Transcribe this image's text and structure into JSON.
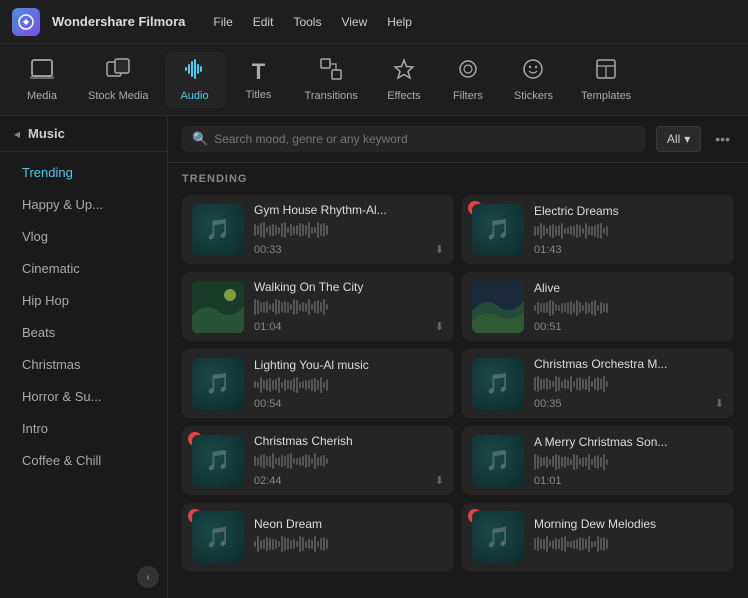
{
  "app": {
    "logo": "W",
    "name": "Wondershare Filmora"
  },
  "titlebar": {
    "menus": [
      "File",
      "Edit",
      "Tools",
      "View",
      "Help"
    ]
  },
  "toolbar": {
    "items": [
      {
        "id": "media",
        "label": "Media",
        "icon": "⬛",
        "active": false
      },
      {
        "id": "stock",
        "label": "Stock Media",
        "icon": "🎞",
        "active": false
      },
      {
        "id": "audio",
        "label": "Audio",
        "icon": "🎵",
        "active": true
      },
      {
        "id": "titles",
        "label": "Titles",
        "icon": "T",
        "active": false
      },
      {
        "id": "transitions",
        "label": "Transitions",
        "icon": "⧉",
        "active": false
      },
      {
        "id": "effects",
        "label": "Effects",
        "icon": "✦",
        "active": false
      },
      {
        "id": "filters",
        "label": "Filters",
        "icon": "◎",
        "active": false
      },
      {
        "id": "stickers",
        "label": "Stickers",
        "icon": "🎭",
        "active": false
      },
      {
        "id": "templates",
        "label": "Templates",
        "icon": "⬜",
        "active": false
      }
    ]
  },
  "sidebar": {
    "header": "Music",
    "items": [
      {
        "id": "trending",
        "label": "Trending",
        "active": true
      },
      {
        "id": "happy",
        "label": "Happy & Up...",
        "active": false
      },
      {
        "id": "vlog",
        "label": "Vlog",
        "active": false
      },
      {
        "id": "cinematic",
        "label": "Cinematic",
        "active": false
      },
      {
        "id": "hiphop",
        "label": "Hip Hop",
        "active": false
      },
      {
        "id": "beats",
        "label": "Beats",
        "active": false
      },
      {
        "id": "christmas",
        "label": "Christmas",
        "active": false
      },
      {
        "id": "horror",
        "label": "Horror & Su...",
        "active": false
      },
      {
        "id": "intro",
        "label": "Intro",
        "active": false
      },
      {
        "id": "coffee",
        "label": "Coffee & Chill",
        "active": false
      }
    ]
  },
  "search": {
    "placeholder": "Search mood, genre or any keyword"
  },
  "filter": {
    "label": "All"
  },
  "section": {
    "title": "TRENDING"
  },
  "music": {
    "items": [
      {
        "id": "gym",
        "title": "Gym House Rhythm-Al...",
        "duration": "00:33",
        "premium": false,
        "thumb": "teal",
        "dl": true
      },
      {
        "id": "electric",
        "title": "Electric Dreams",
        "duration": "01:43",
        "premium": true,
        "thumb": "teal",
        "dl": false
      },
      {
        "id": "walking",
        "title": "Walking On The City",
        "duration": "01:04",
        "premium": false,
        "thumb": "scenic",
        "dl": true
      },
      {
        "id": "alive",
        "title": "Alive",
        "duration": "00:51",
        "premium": false,
        "thumb": "scenic",
        "dl": false
      },
      {
        "id": "lighting",
        "title": "Lighting You-Al music",
        "duration": "00:54",
        "premium": false,
        "thumb": "teal",
        "dl": false
      },
      {
        "id": "christmas_o",
        "title": "Christmas Orchestra M...",
        "duration": "00:35",
        "premium": false,
        "thumb": "teal",
        "dl": true
      },
      {
        "id": "cherish",
        "title": "Christmas Cherish",
        "duration": "02:44",
        "premium": true,
        "thumb": "teal",
        "dl": true
      },
      {
        "id": "merry",
        "title": "A Merry Christmas Son...",
        "duration": "01:01",
        "premium": false,
        "thumb": "teal",
        "dl": false
      },
      {
        "id": "neon",
        "title": "Neon Dream",
        "duration": "",
        "premium": true,
        "thumb": "teal",
        "dl": false
      },
      {
        "id": "morning",
        "title": "Morning Dew Melodies",
        "duration": "",
        "premium": true,
        "thumb": "teal",
        "dl": false
      }
    ]
  }
}
